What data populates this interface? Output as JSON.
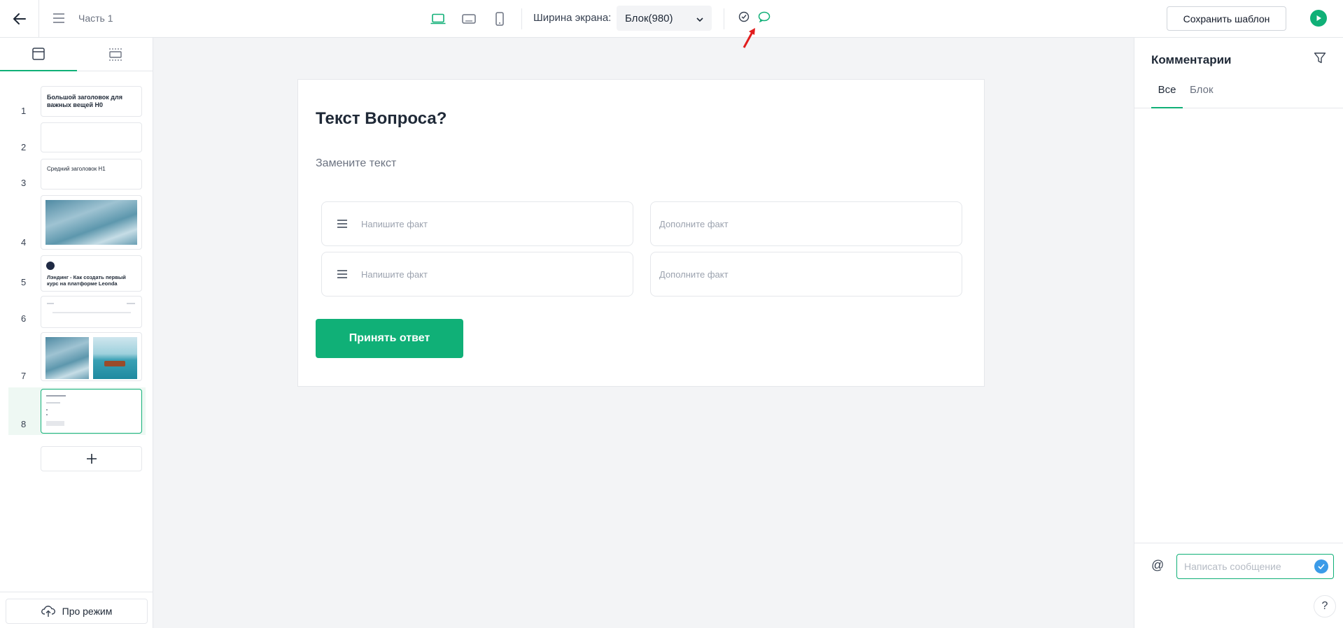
{
  "topbar": {
    "title": "Часть 1",
    "width_label": "Ширина экрана:",
    "width_value": "Блок(980)",
    "save_label": "Сохранить шаблон",
    "devices": [
      "laptop-icon",
      "tablet-landscape-icon",
      "phone-icon"
    ],
    "accent": "#10b077"
  },
  "sidebar": {
    "slides": [
      {
        "num": "1",
        "text": "Большой заголовок для важных вещей H0"
      },
      {
        "num": "2",
        "text": ""
      },
      {
        "num": "3",
        "text": "Средний заголовок H1"
      },
      {
        "num": "4",
        "text": ""
      },
      {
        "num": "5",
        "text": "Лэндинг - Как создать первый курс на платформе Leonda"
      },
      {
        "num": "6",
        "text": ""
      },
      {
        "num": "7",
        "text": ""
      },
      {
        "num": "8",
        "text": ""
      }
    ],
    "active_slide": "8",
    "pro_mode_label": "Про режим"
  },
  "canvas": {
    "question": "Текст Вопроса?",
    "subtitle": "Замените текст",
    "facts": [
      {
        "left": "Напишите факт",
        "right": "Дополните факт"
      },
      {
        "left": "Напишите факт",
        "right": "Дополните факт"
      }
    ],
    "accept_label": "Принять ответ"
  },
  "comments": {
    "title": "Комментарии",
    "tabs": [
      "Все",
      "Блок"
    ],
    "active_tab": "Все",
    "at_symbol": "@",
    "input_placeholder": "Написать сообщение",
    "help": "?"
  }
}
